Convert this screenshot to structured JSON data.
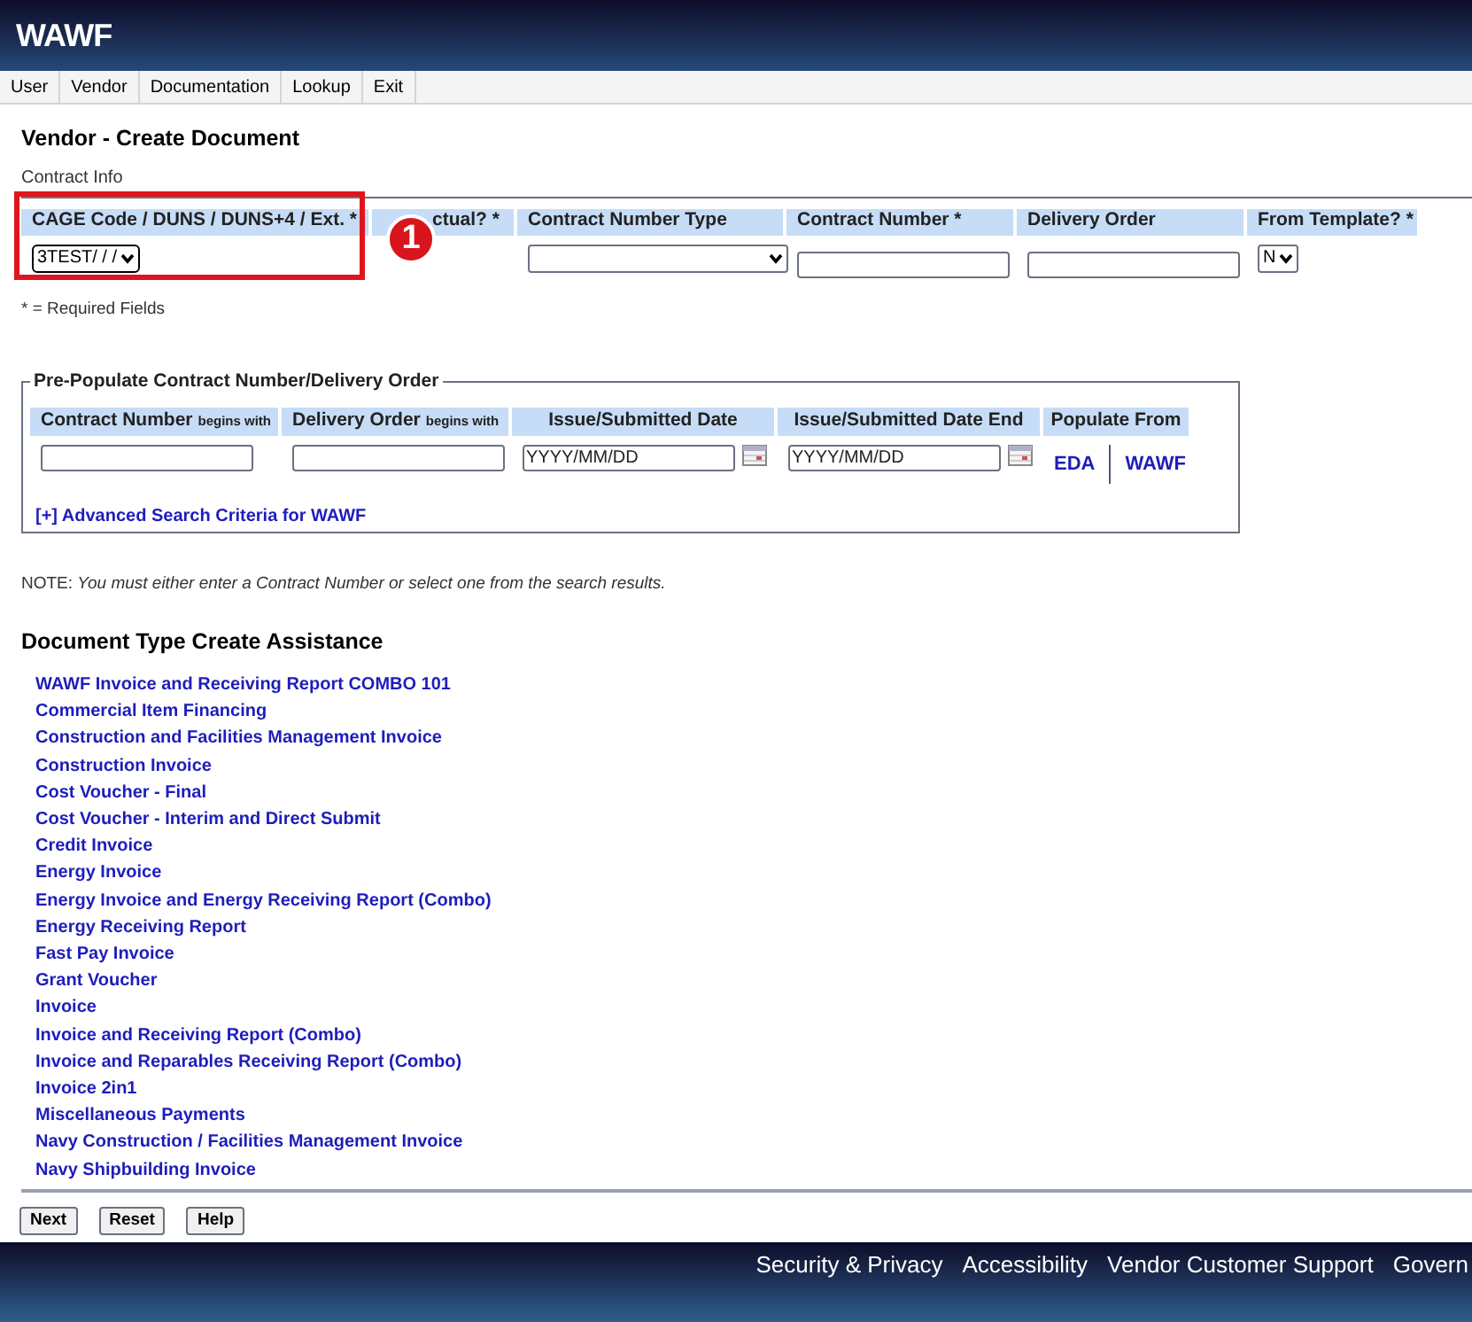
{
  "app": {
    "logo": "WAWF"
  },
  "menu": [
    {
      "label": "User"
    },
    {
      "label": "Vendor"
    },
    {
      "label": "Documentation"
    },
    {
      "label": "Lookup"
    },
    {
      "label": "Exit"
    }
  ],
  "page_title": "Vendor - Create Document",
  "contract_info": {
    "legend": "Contract Info",
    "columns": [
      {
        "header": "CAGE Code / DUNS / DUNS+4 / Ext. *",
        "kind": "select",
        "value": "3TEST/ / /",
        "highlighted": true
      },
      {
        "header": "ctual? *",
        "kind": "blank"
      },
      {
        "header": "Contract Number Type",
        "kind": "select"
      },
      {
        "header": "Contract Number *",
        "kind": "input"
      },
      {
        "header": "Delivery Order",
        "kind": "input"
      },
      {
        "header": "From Template? *",
        "kind": "select",
        "value": "N"
      }
    ],
    "callout": "1",
    "required_note": "* = Required Fields"
  },
  "prepopulate": {
    "legend": "Pre-Populate Contract Number/Delivery Order",
    "columns": [
      {
        "header": "Contract Number",
        "suffix": "begins with",
        "kind": "input"
      },
      {
        "header": "Delivery Order",
        "suffix": "begins with",
        "kind": "input"
      },
      {
        "header": "Issue/Submitted Date",
        "kind": "date",
        "placeholder": "YYYY/MM/DD"
      },
      {
        "header": "Issue/Submitted Date End",
        "kind": "date",
        "placeholder": "YYYY/MM/DD"
      },
      {
        "header": "Populate From",
        "kind": "links",
        "links": [
          "EDA",
          "WAWF"
        ]
      }
    ],
    "advanced_link": "[+] Advanced Search Criteria for WAWF"
  },
  "note": {
    "label": "NOTE:",
    "text": "You must either enter a Contract Number or select one from the search results."
  },
  "assistance": {
    "title": "Document Type Create Assistance",
    "items": [
      "WAWF Invoice and Receiving Report COMBO 101",
      "Commercial Item Financing",
      "Construction and Facilities Management Invoice",
      "Construction Invoice",
      "Cost Voucher - Final",
      "Cost Voucher - Interim and Direct Submit",
      "Credit Invoice",
      "Energy Invoice",
      "Energy Invoice and Energy Receiving Report (Combo)",
      "Energy Receiving Report",
      "Fast Pay Invoice",
      "Grant Voucher",
      "Invoice",
      "Invoice and Receiving Report (Combo)",
      "Invoice and Reparables Receiving Report (Combo)",
      "Invoice 2in1",
      "Miscellaneous Payments",
      "Navy Construction / Facilities Management Invoice",
      "Navy Shipbuilding Invoice"
    ]
  },
  "buttons": [
    "Next",
    "Reset",
    "Help"
  ],
  "footer": [
    "Security & Privacy",
    "Accessibility",
    "Vendor Customer Support",
    "Govern"
  ]
}
